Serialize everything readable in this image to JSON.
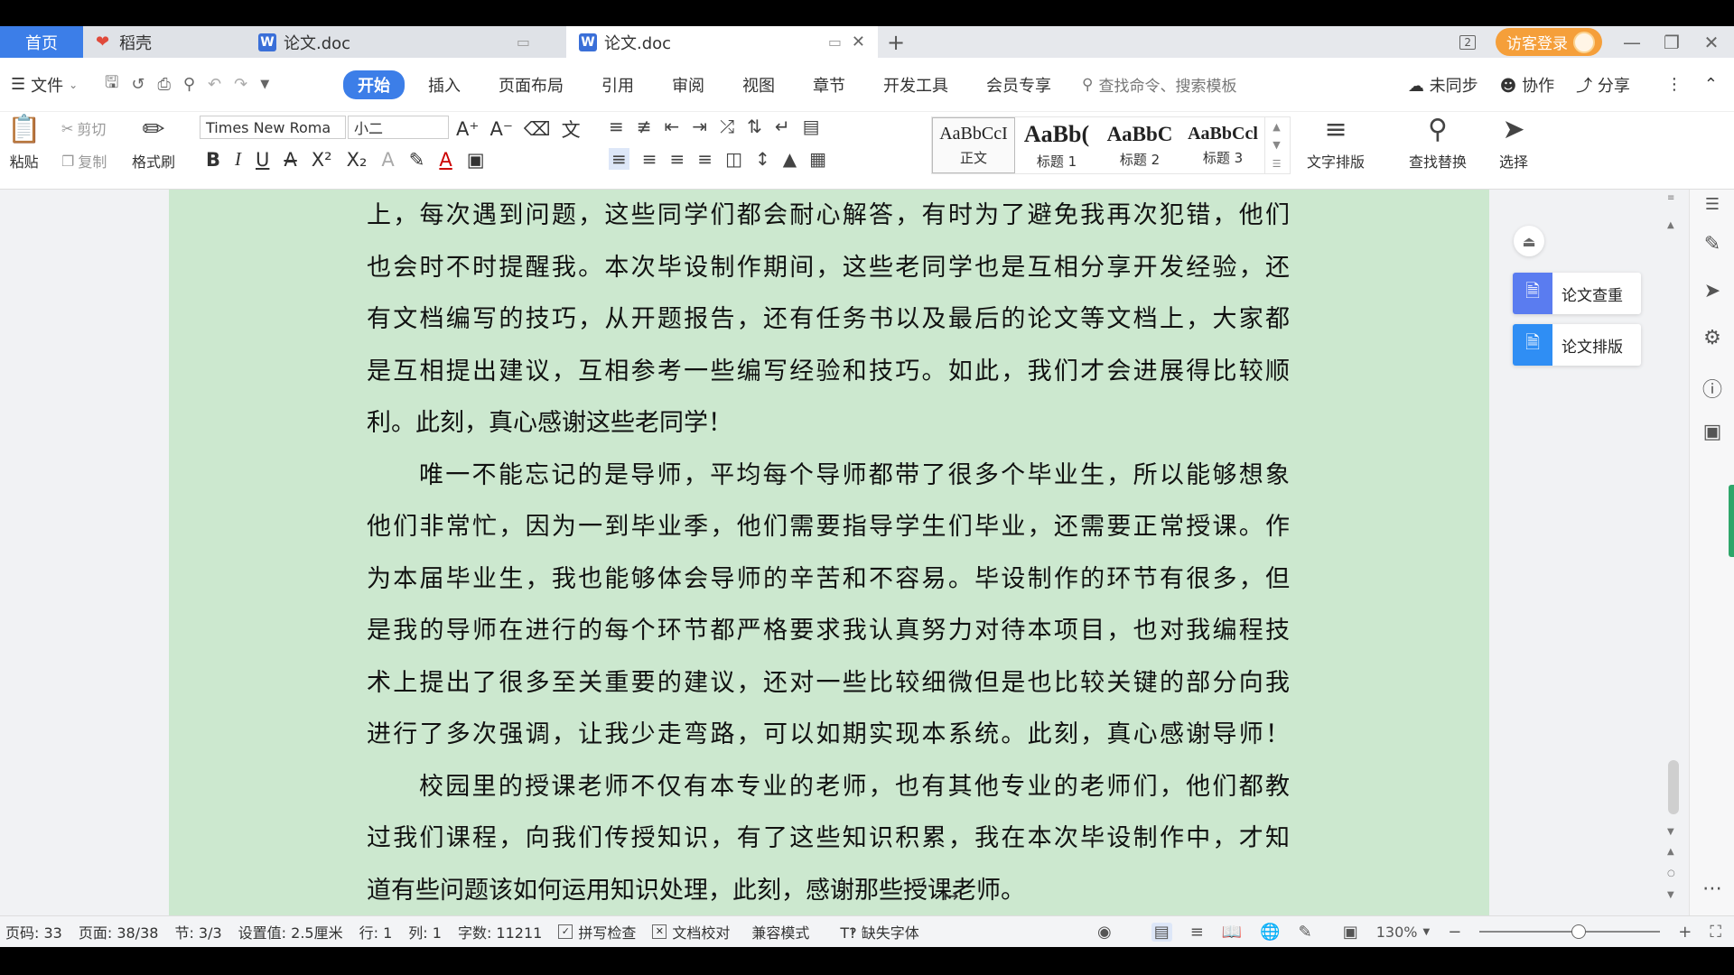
{
  "tabs": {
    "home": "首页",
    "daoke": "稻壳",
    "doc1": "论文.doc",
    "doc2": "论文.doc",
    "new_tab": "+"
  },
  "titlebar": {
    "window_count": "2",
    "visitor_login": "访客登录"
  },
  "menu": {
    "file": "文件",
    "ribbon_tabs": [
      "开始",
      "插入",
      "页面布局",
      "引用",
      "审阅",
      "视图",
      "章节",
      "开发工具",
      "会员专享"
    ],
    "active_tab": "开始",
    "search_placeholder": "查找命令、搜索模板",
    "sync": "未同步",
    "collab": "协作",
    "share": "分享"
  },
  "ribbon": {
    "paste": "粘贴",
    "cut": "剪切",
    "copy": "复制",
    "format_painter": "格式刷",
    "font_name": "Times New Roma",
    "font_size": "小二",
    "styles": [
      {
        "sample": "AaBbCcI",
        "name": "正文"
      },
      {
        "sample": "AaBb(",
        "name": "标题 1"
      },
      {
        "sample": "AaBbC",
        "name": "标题 2"
      },
      {
        "sample": "AaBbCcl",
        "name": "标题 3"
      }
    ],
    "text_layout": "文字排版",
    "find_replace": "查找替换",
    "select": "选择"
  },
  "document": {
    "lines": [
      "上，每次遇到问题，这些同学们都会耐心解答，有时为了避免我再次犯错，他们",
      "也会时不时提醒我。本次毕设制作期间，这些老同学也是互相分享开发经验，还",
      "有文档编写的技巧，从开题报告，还有任务书以及最后的论文等文档上，大家都",
      "是互相提出建议，互相参考一些编写经验和技巧。如此，我们才会进展得比较顺",
      "利。此刻，真心感谢这些老同学！",
      "唯一不能忘记的是导师，平均每个导师都带了很多个毕业生，所以能够想象",
      "他们非常忙，因为一到毕业季，他们需要指导学生们毕业，还需要正常授课。作",
      "为本届毕业生，我也能够体会导师的辛苦和不容易。毕设制作的环节有很多，但",
      "是我的导师在进行的每个环节都严格要求我认真努力对待本项目，也对我编程技",
      "术上提出了很多至关重要的建议，还对一些比较细微但是也比较关键的部分向我",
      "进行了多次强调，让我少走弯路，可以如期实现本系统。此刻，真心感谢导师！",
      "校园里的授课老师不仅有本专业的老师，也有其他专业的老师们，他们都教",
      "过我们课程，向我们传授知识，有了这些知识积累，我在本次毕设制作中，才知",
      "道有些问题该如何运用知识处理，此刻，感谢那些授课老师。"
    ]
  },
  "side_panel": {
    "check": "论文查重",
    "layout": "论文排版"
  },
  "status": {
    "page_code": "页码: 33",
    "page": "页面: 38/38",
    "section": "节: 3/3",
    "setting": "设置值: 2.5厘米",
    "row": "行: 1",
    "col": "列: 1",
    "word_count": "字数: 11211",
    "spell_check": "拼写检查",
    "doc_proof": "文档校对",
    "compat_mode": "兼容模式",
    "missing_font": "缺失字体",
    "zoom": "130%",
    "zoom_level": 0.55
  },
  "colors": {
    "accent": "#3c7ee8",
    "page_bg": "#cce8cf",
    "visitor": "#f59f3a"
  }
}
